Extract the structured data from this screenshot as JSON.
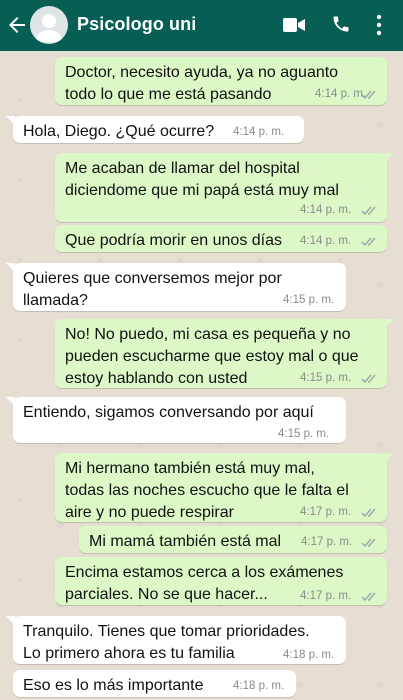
{
  "header": {
    "contact_name": "Psicologo uni",
    "icons": [
      "back-arrow-icon",
      "avatar-icon",
      "video-call-icon",
      "voice-call-icon",
      "more-options-icon"
    ],
    "color": "#075e54"
  },
  "colors": {
    "outgoing": "#dcf8c6",
    "incoming": "#ffffff",
    "read_ticks": "#4fc3f7"
  },
  "messages": [
    {
      "dir": "out",
      "text": "Doctor, necesito ayuda, ya no aguanto\ntodo lo que me está pasando",
      "time": "4:14 p. m.",
      "read": true
    },
    {
      "dir": "in",
      "text": "Hola, Diego. ¿Qué ocurre?",
      "time": "4:14 p. m."
    },
    {
      "dir": "out",
      "text": "Me acaban de llamar del hospital\ndiciendome que mi papá está muy mal",
      "time": "4:14 p. m.",
      "read": true
    },
    {
      "dir": "out",
      "text": "Que podría morir en unos días",
      "time": "4:14 p. m.",
      "read": true
    },
    {
      "dir": "in",
      "text": "Quieres que conversemos mejor por\nllamada?",
      "time": "4:15 p. m."
    },
    {
      "dir": "out",
      "text": "No! No puedo, mi casa es pequeña y no\npueden escucharme que estoy mal o que\nestoy hablando con usted",
      "time": "4:15 p. m.",
      "read": true
    },
    {
      "dir": "in",
      "text": "Entiendo, sigamos conversando por aquí",
      "time": "4:15 p. m."
    },
    {
      "dir": "out",
      "text": "Mi hermano también está muy mal,\ntodas las noches escucho que le falta el\naire y no puede respirar",
      "time": "4:17 p. m.",
      "read": true
    },
    {
      "dir": "out",
      "text": "Mi mamá también está mal",
      "time": "4:17 p. m.",
      "read": true
    },
    {
      "dir": "out",
      "text": "Encima estamos cerca a los exámenes\nparciales. No se que hacer...",
      "time": "4:17 p. m.",
      "read": true
    },
    {
      "dir": "in",
      "text": "Tranquilo. Tienes que tomar prioridades.\nLo primero ahora es tu familia",
      "time": "4:18 p. m."
    },
    {
      "dir": "in",
      "text": "Eso es lo más importante",
      "time": "4:18 p. m."
    }
  ]
}
